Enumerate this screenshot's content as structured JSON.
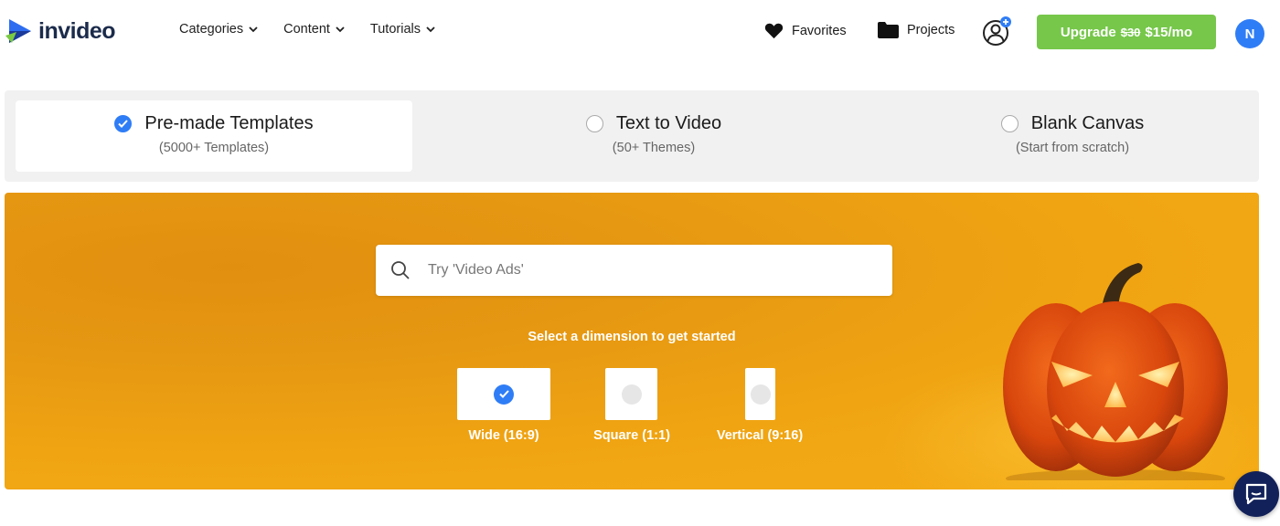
{
  "header": {
    "logo_text": "invideo",
    "nav": [
      {
        "label": "Categories"
      },
      {
        "label": "Content"
      },
      {
        "label": "Tutorials"
      }
    ],
    "favorites_label": "Favorites",
    "projects_label": "Projects",
    "upgrade": {
      "label": "Upgrade",
      "old_price": "$30",
      "new_price": "$15/mo"
    },
    "avatar_initial": "N"
  },
  "modes": [
    {
      "title": "Pre-made Templates",
      "subtitle": "(5000+ Templates)",
      "selected": true
    },
    {
      "title": "Text to Video",
      "subtitle": "(50+ Themes)",
      "selected": false
    },
    {
      "title": "Blank Canvas",
      "subtitle": "(Start from scratch)",
      "selected": false
    }
  ],
  "hero": {
    "search_placeholder": "Try 'Video Ads'",
    "dimension_prompt": "Select a dimension to get started",
    "dimensions": [
      {
        "label": "Wide (16:9)",
        "selected": true
      },
      {
        "label": "Square (1:1)",
        "selected": false
      },
      {
        "label": "Vertical (9:16)",
        "selected": false
      }
    ]
  },
  "colors": {
    "accent_blue": "#2f7df6",
    "upgrade_green": "#76c74a",
    "hero_orange": "#f0a412",
    "chat_navy": "#13215a"
  },
  "icons": {
    "search": "search-icon",
    "chevron": "chevron-down-icon",
    "favorites": "heart-icon",
    "projects": "folder-icon",
    "add_user": "add-user-icon",
    "chat": "chat-icon",
    "check": "check-icon"
  }
}
